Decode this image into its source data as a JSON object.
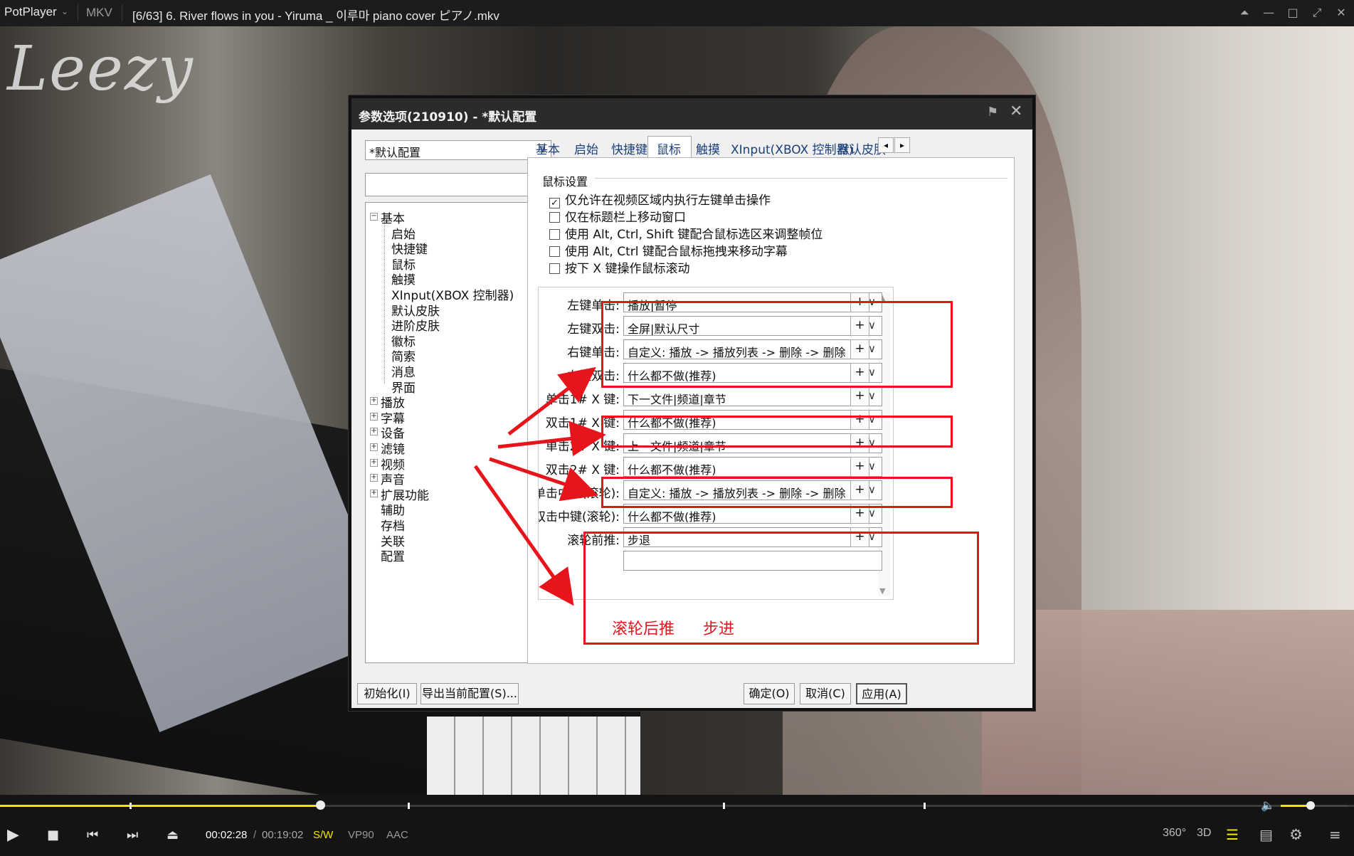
{
  "titlebar": {
    "app_name": "PotPlayer",
    "format": "MKV",
    "file_title": "[6/63] 6. River flows in you - Yiruma _ 이루마 piano cover ピアノ.mkv"
  },
  "video": {
    "watermark": "Leezy"
  },
  "dialog": {
    "title": "参数选项(210910) - *默认配置",
    "profile_value": "*默认配置",
    "search_placeholder": "",
    "tree": [
      {
        "label": "基本",
        "expanded": true
      },
      {
        "label": "启始",
        "child": true
      },
      {
        "label": "快捷键",
        "child": true
      },
      {
        "label": "鼠标",
        "child": true
      },
      {
        "label": "触摸",
        "child": true
      },
      {
        "label": "XInput(XBOX 控制器)",
        "child": true
      },
      {
        "label": "默认皮肤",
        "child": true
      },
      {
        "label": "进阶皮肤",
        "child": true
      },
      {
        "label": "徽标",
        "child": true
      },
      {
        "label": "简索",
        "child": true
      },
      {
        "label": "消息",
        "child": true
      },
      {
        "label": "界面",
        "child": true
      },
      {
        "label": "播放",
        "expandable": true
      },
      {
        "label": "字幕",
        "expandable": true
      },
      {
        "label": "设备",
        "expandable": true
      },
      {
        "label": "滤镜",
        "expandable": true
      },
      {
        "label": "视频",
        "expandable": true
      },
      {
        "label": "声音",
        "expandable": true
      },
      {
        "label": "扩展功能",
        "expandable": true
      },
      {
        "label": "辅助"
      },
      {
        "label": "存档"
      },
      {
        "label": "关联"
      },
      {
        "label": "配置"
      }
    ],
    "tabs": [
      "基本",
      "启始",
      "快捷键",
      "鼠标",
      "触摸",
      "XInput(XBOX 控制器)",
      "默认皮肤"
    ],
    "active_tab": "鼠标",
    "group_title": "鼠标设置",
    "checkboxes": [
      {
        "label": "仅允许在视频区域内执行左键单击操作",
        "checked": true
      },
      {
        "label": "仅在标题栏上移动窗口",
        "checked": false
      },
      {
        "label": "使用 Alt, Ctrl, Shift 键配合鼠标选区来调整帧位",
        "checked": false
      },
      {
        "label": "使用 Alt, Ctrl 键配合鼠标拖拽来移动字幕",
        "checked": false
      },
      {
        "label": "按下 X 键操作鼠标滚动",
        "checked": false
      }
    ],
    "mappings": [
      {
        "label": "左键单击:",
        "value": "播放|暂停"
      },
      {
        "label": "左键双击:",
        "value": "全屏|默认尺寸"
      },
      {
        "label": "右键单击:",
        "value": "自定义:  播放 -> 播放列表 -> 删除 -> 删除"
      },
      {
        "label": "右键双击:",
        "value": "什么都不做(推荐)"
      },
      {
        "label": "单击1# X 键:",
        "value": "下一文件|频道|章节"
      },
      {
        "label": "双击1# X 键:",
        "value": "什么都不做(推荐)"
      },
      {
        "label": "单击2# X 键:",
        "value": "上一文件|频道|章节"
      },
      {
        "label": "双击2# X 键:",
        "value": "什么都不做(推荐)"
      },
      {
        "label": "单击中键(滚轮):",
        "value": "自定义:  播放 -> 播放列表 -> 删除 -> 删除"
      },
      {
        "label": "双击中键(滚轮):",
        "value": "什么都不做(推荐)"
      },
      {
        "label": "滚轮前推:",
        "value": "步退"
      }
    ],
    "plus_label": "+",
    "annotation": {
      "left": "滚轮后推",
      "right": "步进"
    },
    "buttons": {
      "init": "初始化(I)",
      "export": "导出当前配置(S)...",
      "ok": "确定(O)",
      "cancel": "取消(C)",
      "apply": "应用(A)"
    }
  },
  "controls": {
    "current_time": "00:02:28",
    "separator": "/",
    "total_time": "00:19:02",
    "sw": "S/W",
    "codec": "VP90",
    "audio": "AAC",
    "icon_360": "360°",
    "icon_3d": "3D",
    "progress": 0.12
  }
}
